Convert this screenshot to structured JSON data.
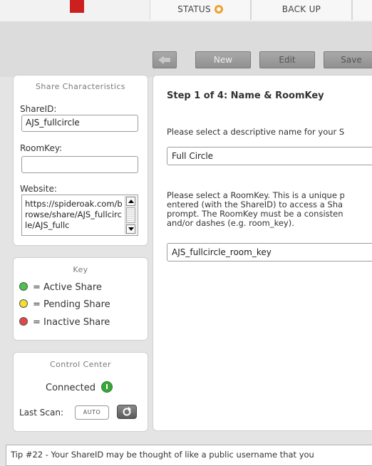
{
  "header": {
    "tabs": [
      {
        "label": "STATUS",
        "icon": "gear-icon"
      },
      {
        "label": "BACK UP"
      }
    ]
  },
  "toolbar": {
    "new_label": "New",
    "edit_label": "Edit",
    "save_label": "Save"
  },
  "share_characteristics": {
    "title": "Share Characteristics",
    "shareid_label": "ShareID:",
    "shareid_value": "AJS_fullcircle",
    "roomkey_label": "RoomKey:",
    "roomkey_value": "",
    "website_label": "Website:",
    "website_value": "https://spideroak.com/browse/share/AJS_fullcircle/AJS_fullc"
  },
  "key": {
    "title": "Key",
    "items": [
      {
        "label": "= Active Share",
        "color": "#4cc44c"
      },
      {
        "label": "= Pending Share",
        "color": "#f2e030"
      },
      {
        "label": "= Inactive Share",
        "color": "#e04848"
      }
    ]
  },
  "control_center": {
    "title": "Control Center",
    "status": "Connected",
    "status_color": "#3aa63a",
    "last_scan_label": "Last Scan:",
    "last_scan_value": "AUTO"
  },
  "main": {
    "step_title": "Step 1 of 4: Name & RoomKey",
    "name_prompt": "Please select a descriptive name for your S",
    "name_value": "Full Circle",
    "roomkey_prompt_lines": [
      "Please select a RoomKey. This is a unique p",
      "entered (with the ShareID) to access a Sha",
      "prompt. The RoomKey must be a consisten",
      "and/or dashes (e.g. room_key)."
    ],
    "roomkey_value": "AJS_fullcircle_room_key"
  },
  "tip": "Tip #22 - Your ShareID may be thought of like a public username that you"
}
